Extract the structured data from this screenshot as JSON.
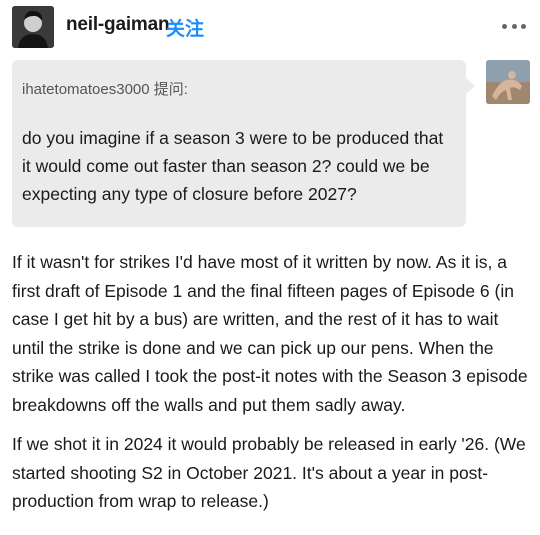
{
  "header": {
    "username": "neil-gaiman",
    "follow_label": "关注",
    "more_icon": "more-horizontal-icon"
  },
  "ask": {
    "asker_label": "ihatetomatoes3000 提问:",
    "question": "do you imagine if a season 3 were to be produced that it would come out faster than season 2? could we be expecting any type of closure before 2027?"
  },
  "answer": {
    "paragraph_1": "If it wasn't for strikes I'd have most of it written by now. As it is, a first draft of Episode 1 and the final fifteen pages of Episode 6 (in case I get hit by a bus) are written, and the rest of it has to wait until the strike is done and we can pick up our pens. When the strike was called I took the post-it notes with the Season 3 episode breakdowns off the walls and put them sadly away.",
    "paragraph_2": "If we shot it in 2024 it would probably be released in early '26. (We started shooting S2 in October 2021. It's about a year in post-production from wrap to release.)"
  },
  "colors": {
    "follow": "#1a8cff",
    "ask_background": "#ebebeb",
    "text": "#1a1a1a"
  }
}
